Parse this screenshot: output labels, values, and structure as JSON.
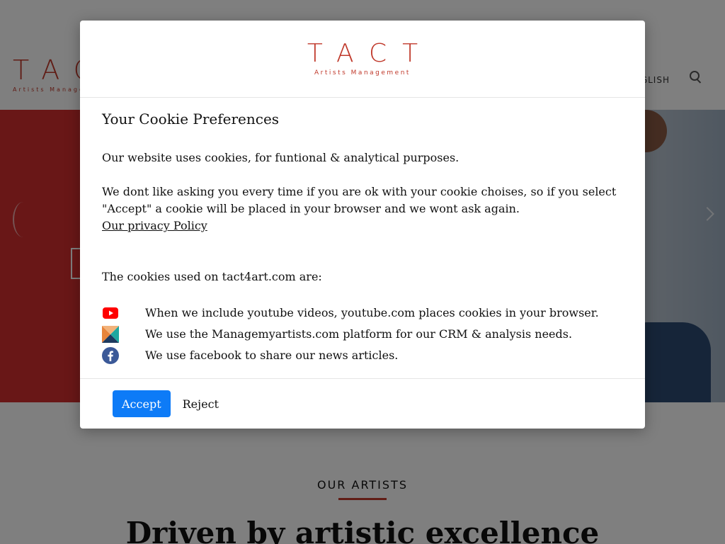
{
  "site": {
    "logo_word": "TACT",
    "logo_sub": "Artists Management",
    "nav_label": "ENGLISH",
    "section_kicker": "OUR ARTISTS",
    "section_heading": "Driven by artistic excellence"
  },
  "modal": {
    "brand": {
      "word": "TACT",
      "sub": "Artists Management",
      "color": "#c0392b"
    },
    "title": "Your Cookie Preferences",
    "intro": "Our website uses cookies, for funtional & analytical purposes.",
    "explanation": "We dont like asking you every time if you are ok with your cookie choises, so if you select \"Accept\" a cookie will be placed in your browser and we wont ask again.",
    "privacy_link": "Our privacy Policy",
    "cookies_intro": "The cookies used on tact4art.com are:",
    "cookies": [
      {
        "icon": "youtube-icon",
        "text": "When we include youtube videos, youtube.com places cookies in your browser."
      },
      {
        "icon": "managemyartists-icon",
        "text": "We use the Managemyartists.com platform for our CRM & analysis needs."
      },
      {
        "icon": "facebook-icon",
        "text": "We use facebook to share our news articles."
      }
    ],
    "buttons": {
      "accept": "Accept",
      "reject": "Reject"
    },
    "accent_color": "#0d7bf7"
  }
}
